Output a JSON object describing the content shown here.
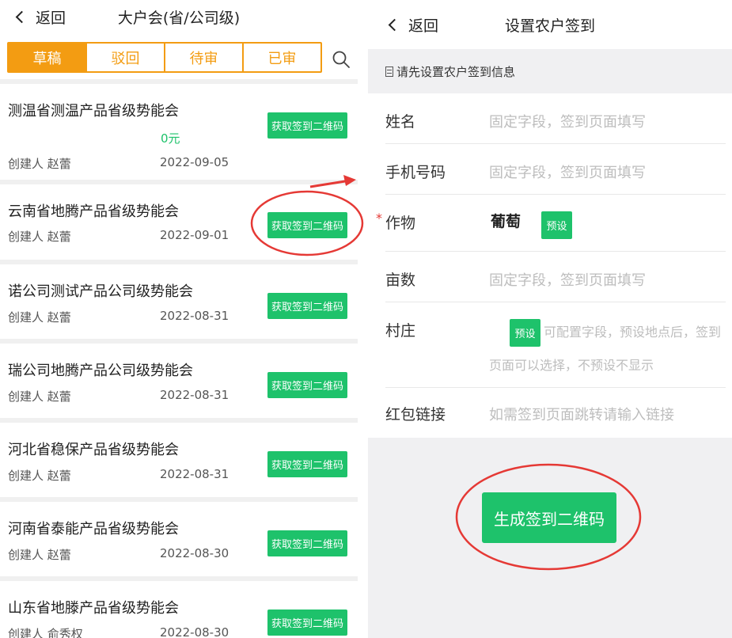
{
  "left": {
    "back_label": "返回",
    "title": "大户会(省/公司级)",
    "tabs": [
      {
        "label": "草稿",
        "active": true
      },
      {
        "label": "驳回",
        "active": false
      },
      {
        "label": "待审",
        "active": false
      },
      {
        "label": "已审",
        "active": false
      }
    ],
    "search_icon": "search-icon",
    "qr_button_label": "获取签到二维码",
    "items": [
      {
        "title": "测温省测温产品省级势能会",
        "money": "0元",
        "creator": "创建人  赵蕾",
        "date": "2022-09-05"
      },
      {
        "title": "云南省地腾产品省级势能会",
        "creator": "创建人  赵蕾",
        "date": "2022-09-01"
      },
      {
        "title": "诺公司测试产品公司级势能会",
        "creator": "创建人  赵蕾",
        "date": "2022-08-31"
      },
      {
        "title": "瑞公司地腾产品公司级势能会",
        "creator": "创建人  赵蕾",
        "date": "2022-08-31"
      },
      {
        "title": "河北省稳保产品省级势能会",
        "creator": "创建人  赵蕾",
        "date": "2022-08-31"
      },
      {
        "title": "河南省泰能产品省级势能会",
        "creator": "创建人  赵蕾",
        "date": "2022-08-30"
      },
      {
        "title": "山东省地滕产品省级势能会",
        "creator": "创建人  俞秀权",
        "date": "2022-08-30"
      }
    ]
  },
  "right": {
    "back_label": "返回",
    "title": "设置农户签到",
    "info": "请先设置农户签到信息",
    "fields": {
      "name": {
        "label": "姓名",
        "placeholder": "固定字段，签到页面填写"
      },
      "phone": {
        "label": "手机号码",
        "placeholder": "固定字段，签到页面填写"
      },
      "crop": {
        "required_mark": "*",
        "label": "作物",
        "value": "葡萄",
        "preset_label": "预设"
      },
      "area": {
        "label": "亩数",
        "placeholder": "固定字段，签到页面填写"
      },
      "village": {
        "label": "村庄",
        "preset_label": "预设",
        "hint_line1": "可配置字段，预设地点后，签到",
        "hint_line2": "页面可以选择，不预设不显示"
      },
      "redpacket": {
        "label": "红包链接",
        "placeholder": "如需签到页面跳转请输入链接"
      }
    },
    "generate_label": "生成签到二维码"
  },
  "colors": {
    "accent_orange": "#f39c12",
    "accent_green": "#1ec26b",
    "annotation_red": "#e53935"
  }
}
